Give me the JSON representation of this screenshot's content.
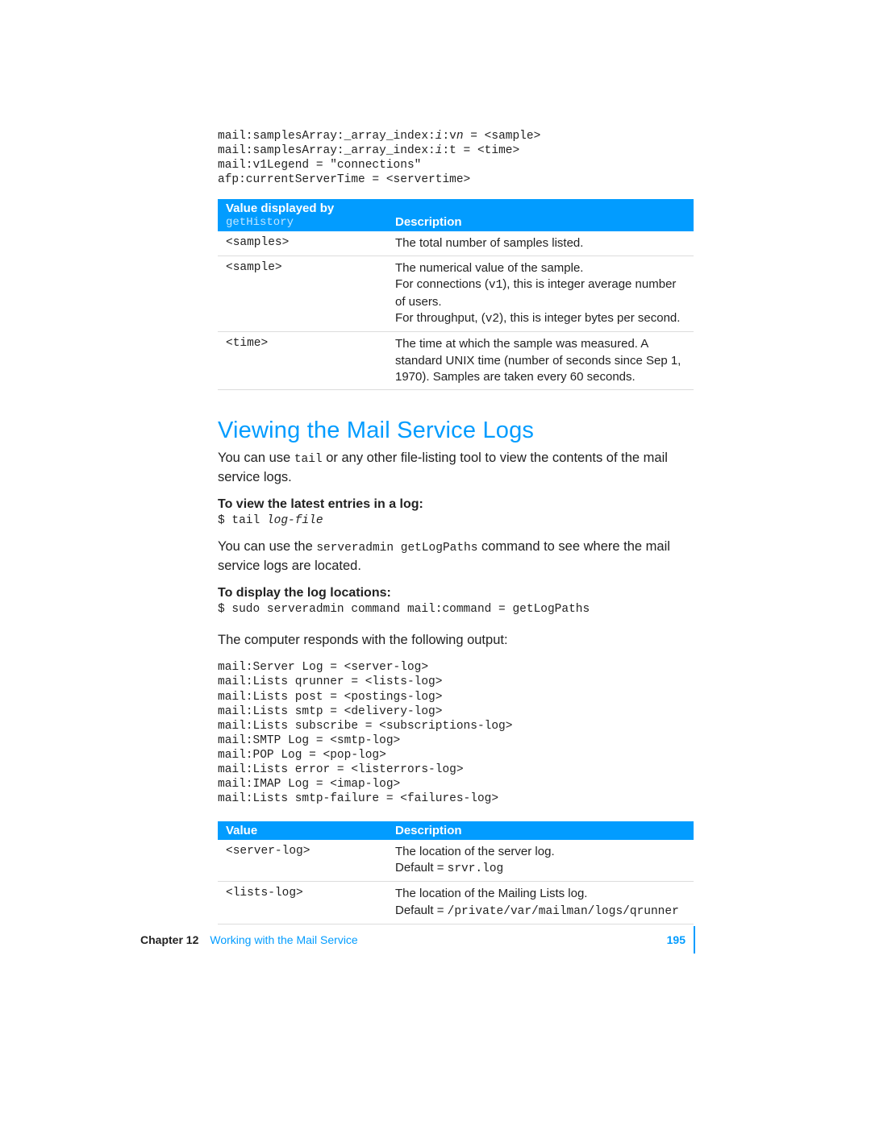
{
  "code1": {
    "l1a": "mail:samplesArray:_array_index:",
    "l1i": "i",
    "l1b": ":v",
    "l1n": "n",
    "l1c": " = <sample>",
    "l2a": "mail:samplesArray:_array_index:",
    "l2i": "i",
    "l2b": ":t = <time>",
    "l3": "mail:v1Legend = \"connections\"",
    "l4": "afp:currentServerTime = <servertime>"
  },
  "table1_header": {
    "col1_line1": "Value displayed by",
    "col1_line2": "getHistory",
    "col2": "Description"
  },
  "table1_rows": {
    "r1_v": "<samples>",
    "r1_d": "The total number of samples listed.",
    "r2_v": "<sample>",
    "r2_d_l1": "The numerical value of the sample.",
    "r2_d_l2a": "For connections (",
    "r2_d_l2b": "v1",
    "r2_d_l2c": "), this is integer average number of users.",
    "r2_d_l3a": "For throughput, (",
    "r2_d_l3b": "v2",
    "r2_d_l3c": "), this is integer bytes per second.",
    "r3_v": "<time>",
    "r3_d": "The time at which the sample was measured. A standard UNIX time (number of seconds since Sep 1, 1970). Samples are taken every 60 seconds."
  },
  "heading": "Viewing the Mail Service Logs",
  "para1_a": "You can use ",
  "para1_b": "tail",
  "para1_c": " or any other file-listing tool to view the contents of the mail service logs.",
  "sub1": "To view the latest entries in a log:",
  "cmd1_a": "$ tail ",
  "cmd1_b": "log-file",
  "para2_a": "You can use the ",
  "para2_b": "serveradmin getLogPaths",
  "para2_c": " command to see where the mail service logs are located.",
  "sub2": "To display the log locations:",
  "cmd2": "$ sudo serveradmin command mail:command = getLogPaths",
  "para3": "The computer responds with the following output:",
  "code2": "mail:Server Log = <server-log>\nmail:Lists qrunner = <lists-log>\nmail:Lists post = <postings-log>\nmail:Lists smtp = <delivery-log>\nmail:Lists subscribe = <subscriptions-log>\nmail:SMTP Log = <smtp-log>\nmail:POP Log = <pop-log>\nmail:Lists error = <listerrors-log>\nmail:IMAP Log = <imap-log>\nmail:Lists smtp-failure = <failures-log>",
  "table2_header": {
    "col1": "Value",
    "col2": "Description"
  },
  "table2_rows": {
    "r1_v": "<server-log>",
    "r1_d_l1": "The location of the server log.",
    "r1_d_l2a": "Default = ",
    "r1_d_l2b": "srvr.log",
    "r2_v": "<lists-log>",
    "r2_d_l1": "The location of the Mailing Lists log.",
    "r2_d_l2a": "Default = ",
    "r2_d_l2b": "/private/var/mailman/logs/qrunner"
  },
  "footer": {
    "chapter": "Chapter 12",
    "title": "Working with the Mail Service",
    "page": "195"
  }
}
